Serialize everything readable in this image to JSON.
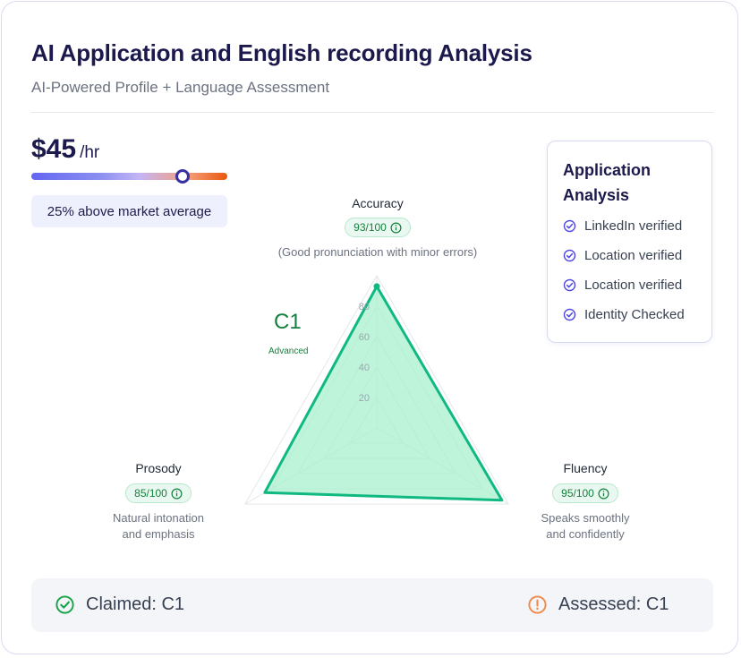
{
  "header": {
    "title": "AI Application and English recording Analysis",
    "subtitle": "AI-Powered Profile + Language Assessment"
  },
  "rate": {
    "value": "$45",
    "unit": "/hr",
    "market_position": 0.77,
    "market_note": "25% above market average"
  },
  "application_analysis": {
    "title": "Application Analysis",
    "items": [
      {
        "label": "LinkedIn verified",
        "icon": "check-circle-icon"
      },
      {
        "label": "Location verified",
        "icon": "check-circle-icon"
      },
      {
        "label": "Location verified",
        "icon": "check-circle-icon"
      },
      {
        "label": "Identity Checked",
        "icon": "check-circle-icon"
      }
    ]
  },
  "level": {
    "code": "C1",
    "name": "Advanced"
  },
  "chart_data": {
    "type": "radar",
    "axes": [
      {
        "name": "Accuracy",
        "score_text": "93/100",
        "value": 93,
        "note": "(Good pronunciation with minor errors)"
      },
      {
        "name": "Fluency",
        "score_text": "95/100",
        "value": 95,
        "note": "Speaks smoothly and confidently"
      },
      {
        "name": "Prosody",
        "score_text": "85/100",
        "value": 85,
        "note": "Natural intonation and emphasis"
      }
    ],
    "range": [
      0,
      100
    ],
    "ticks": [
      "20",
      "40",
      "60",
      "80"
    ],
    "grid": true,
    "fill_color": "#a7f0cd",
    "stroke_color": "#10b981"
  },
  "footer": {
    "claimed": "Claimed: C1",
    "assessed": "Assessed: C1",
    "claimed_icon": "check-circle-icon",
    "assessed_icon": "alert-circle-icon",
    "claimed_color": "#16a34a",
    "assessed_color": "#f08a4b"
  }
}
